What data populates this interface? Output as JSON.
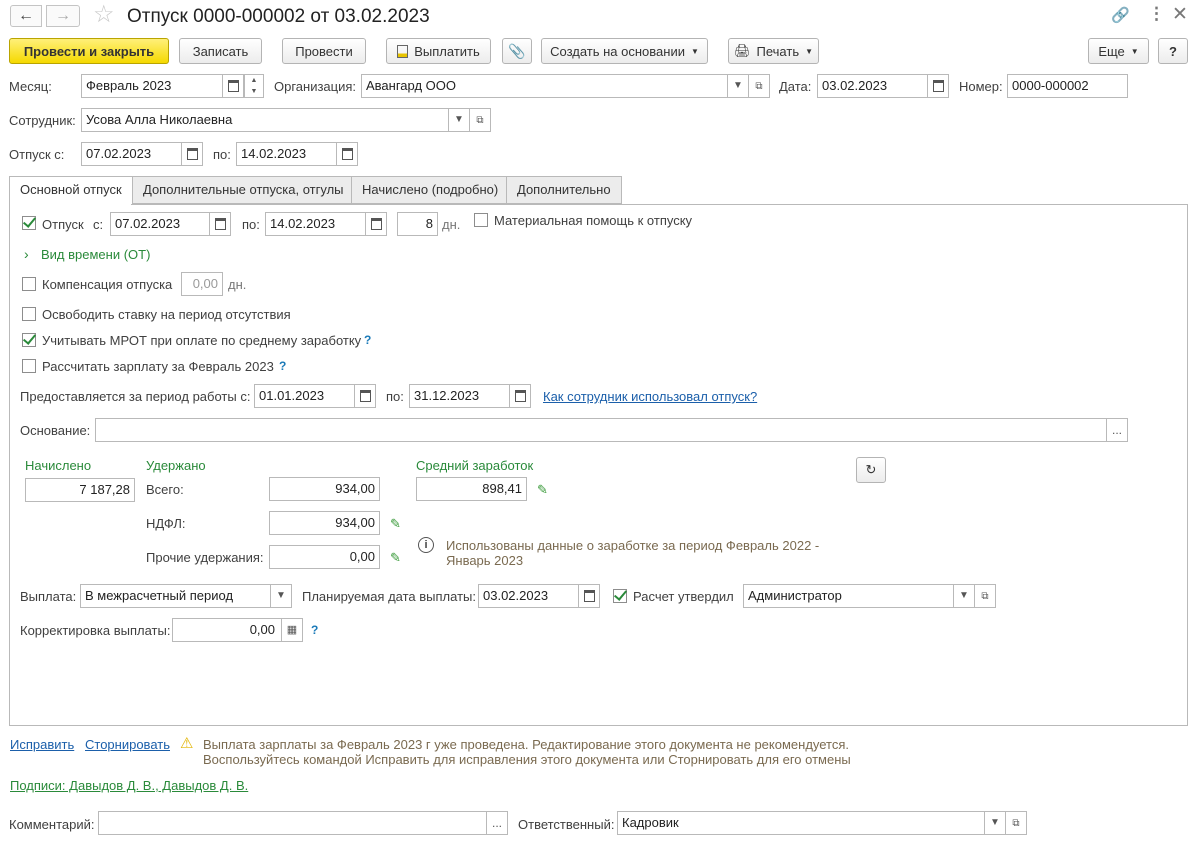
{
  "header": {
    "title": "Отпуск 0000-000002 от 03.02.2023"
  },
  "toolbar": {
    "post_close": "Провести и закрыть",
    "save": "Записать",
    "post": "Провести",
    "pay": "Выплатить",
    "create_based": "Создать на основании",
    "print": "Печать",
    "more": "Еще",
    "help": "?"
  },
  "fields": {
    "month_label": "Месяц:",
    "month_value": "Февраль 2023",
    "org_label": "Организация:",
    "org_value": "Авангард ООО",
    "date_label": "Дата:",
    "date_value": "03.02.2023",
    "number_label": "Номер:",
    "number_value": "0000-000002",
    "employee_label": "Сотрудник:",
    "employee_value": "Усова Алла Николаевна",
    "vac_from_label": "Отпуск с:",
    "vac_from_value": "07.02.2023",
    "vac_to_label": "по:",
    "vac_to_value": "14.02.2023"
  },
  "tabs": [
    {
      "label": "Основной отпуск"
    },
    {
      "label": "Дополнительные отпуска, отгулы"
    },
    {
      "label": "Начислено (подробно)"
    },
    {
      "label": "Дополнительно"
    }
  ],
  "main": {
    "vacation_check": "Отпуск",
    "from_label": "с:",
    "from_value": "07.02.2023",
    "to_label": "по:",
    "to_value": "14.02.2023",
    "days_value": "8",
    "days_unit": "дн.",
    "material_help": "Материальная помощь к отпуску",
    "time_kind": "Вид времени (ОТ)",
    "compensation": "Компенсация отпуска",
    "comp_value": "0,00",
    "comp_unit": "дн.",
    "free_rate": "Освободить ставку на период отсутствия",
    "mrot": "Учитывать МРОТ при оплате по среднему заработку",
    "calc_salary": "Рассчитать зарплату за Февраль 2023",
    "hint": "?",
    "period_label": "Предоставляется за период работы с:",
    "period_from": "01.01.2023",
    "period_to_label": "по:",
    "period_to": "31.12.2023",
    "usage_link": "Как сотрудник использовал отпуск?",
    "basis_label": "Основание:",
    "basis_value": "",
    "accrued_label": "Начислено",
    "accrued_value": "7 187,28",
    "withheld_label": "Удержано",
    "total_label": "Всего:",
    "total_value": "934,00",
    "ndfl_label": "НДФЛ:",
    "ndfl_value": "934,00",
    "other_label": "Прочие удержания:",
    "other_value": "0,00",
    "avg_label": "Средний заработок",
    "avg_value": "898,41",
    "info_text1": "Использованы данные о заработке за период Февраль 2022 -",
    "info_text2": "Январь 2023",
    "payment_label": "Выплата:",
    "payment_value": "В межрасчетный период",
    "plan_date_label": "Планируемая дата выплаты:",
    "plan_date_value": "03.02.2023",
    "approved_label": "Расчет утвердил",
    "approved_value": "Администратор",
    "correction_label": "Корректировка выплаты:",
    "correction_value": "0,00"
  },
  "footer": {
    "fix_link": "Исправить",
    "reverse_link": "Сторнировать",
    "warning1": "Выплата зарплаты за Февраль 2023 г уже проведена. Редактирование этого документа не рекомендуется.",
    "warning2": "Воспользуйтесь командой Исправить для исправления этого документа или Сторнировать для его отмены",
    "signatures": "Подписи: Давыдов Д. В., Давыдов Д. В.",
    "comment_label": "Комментарий:",
    "comment_value": "",
    "responsible_label": "Ответственный:",
    "responsible_value": "Кадровик"
  },
  "colors": {
    "primary_button": "#f5d900",
    "accent_green": "#2a8a3a",
    "link_blue": "#1b5faa"
  }
}
